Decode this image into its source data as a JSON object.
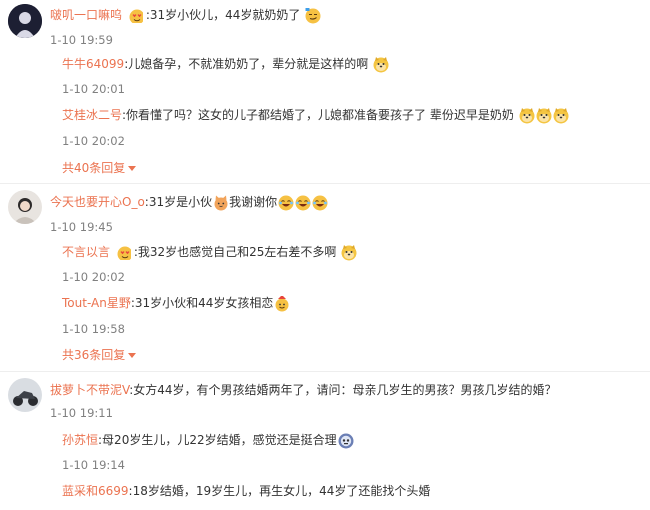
{
  "threads": [
    {
      "user": "啵叽一口嘛呜",
      "text": ":31岁小伙儿，44岁就奶奶了",
      "time": "1-10 19:59",
      "replies": [
        {
          "user": "牛牛64099",
          "text": ":儿媳备孕，不就准奶奶了，辈分就是这样的啊",
          "time": "1-10 20:01"
        },
        {
          "user": "艾桂冰二号",
          "text": ":你看懂了吗？这女的儿子都结婚了，儿媳都准备要孩子了 辈份迟早是奶奶",
          "time": "1-10 20:02"
        }
      ],
      "more": "共40条回复"
    },
    {
      "user": "今天也要开心O_o",
      "text_a": ":31岁是小伙",
      "text_b": "我谢谢你",
      "time": "1-10 19:45",
      "replies": [
        {
          "user": "不言以言",
          "text": ":我32岁也感觉自己和25左右差不多啊",
          "time": "1-10 20:02"
        },
        {
          "user": "Tout-An星野",
          "text": ":31岁小伙和44岁女孩相恋",
          "time": "1-10 19:58"
        }
      ],
      "more": "共36条回复"
    },
    {
      "user": "拔萝卜不带泥V",
      "text": ":女方44岁，有个男孩结婚两年了，请问：母亲几岁生的男孩？男孩几岁结的婚？",
      "time": "1-10 19:11",
      "replies": [
        {
          "user": "孙苏恒",
          "text": ":母20岁生儿，儿22岁结婚，感觉还是挺合理",
          "time": "1-10 19:14"
        },
        {
          "user": "蓝采和6699",
          "text": ":18岁结婚，19岁生儿，再生女儿，44岁了还能找个头婚"
        }
      ]
    }
  ],
  "colors": {
    "username": "#eb7350",
    "text": "#333333",
    "time": "#808080"
  }
}
